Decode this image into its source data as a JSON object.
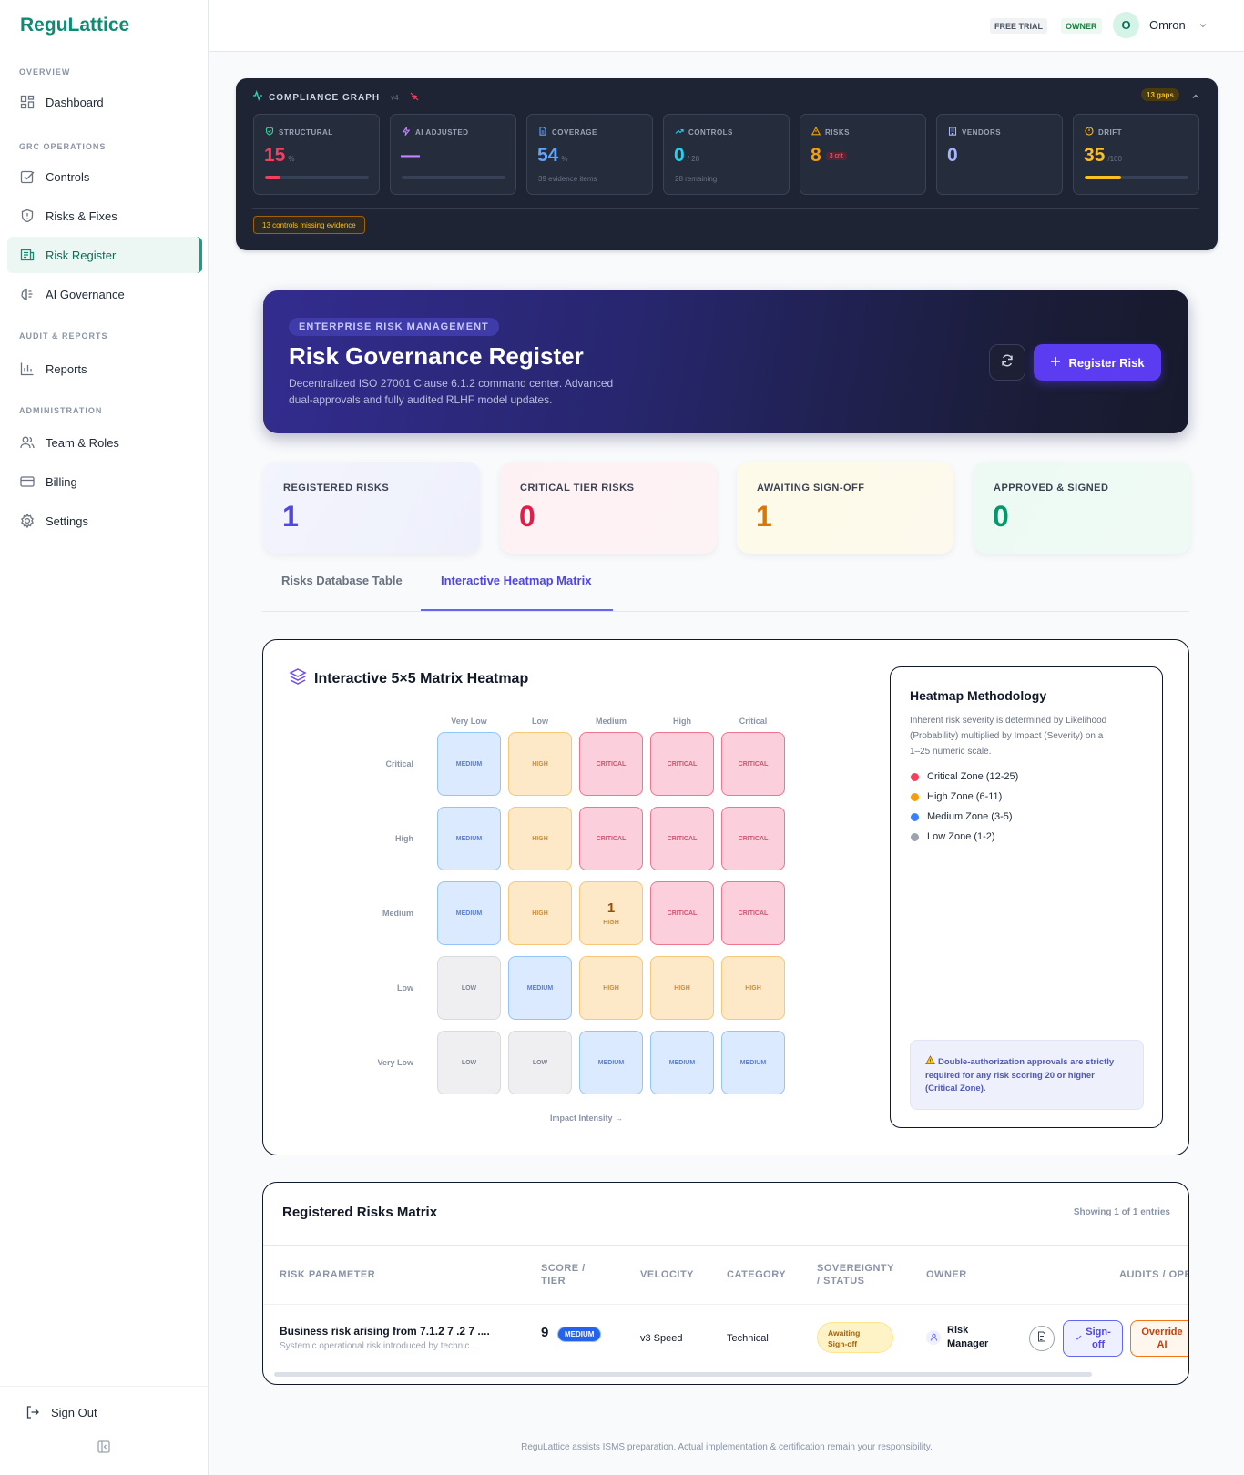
{
  "sidebar": {
    "brand": "ReguLattice",
    "sections": [
      "OVERVIEW",
      "GRC OPERATIONS",
      "AUDIT & REPORTS",
      "ADMINISTRATION"
    ],
    "items": [
      {
        "label": "Dashboard",
        "icon": "grid-icon"
      },
      {
        "label": "Controls",
        "icon": "checkbox-icon"
      },
      {
        "label": "Risks & Fixes",
        "icon": "shield-alert-icon"
      },
      {
        "label": "Risk Register",
        "icon": "register-icon",
        "active": true
      },
      {
        "label": "AI Governance",
        "icon": "brain-icon"
      },
      {
        "label": "Reports",
        "icon": "bar-chart-icon"
      },
      {
        "label": "Team & Roles",
        "icon": "users-icon"
      },
      {
        "label": "Billing",
        "icon": "credit-card-icon"
      },
      {
        "label": "Settings",
        "icon": "gear-icon"
      }
    ],
    "sign_out": "Sign Out"
  },
  "topbar": {
    "free_trial": "FREE TRIAL",
    "role": "OWNER",
    "avatar_initial": "O",
    "user_name": "Omron"
  },
  "compliance_graph": {
    "title": "COMPLIANCE GRAPH",
    "version": "v4",
    "gaps": "13 gaps",
    "cards": [
      {
        "label": "STRUCTURAL",
        "value": "15",
        "unit": "%",
        "progress": 0.15,
        "color": "#f43f5e"
      },
      {
        "label": "AI ADJUSTED",
        "value": "—",
        "progress": 0,
        "color": "#c084fc"
      },
      {
        "label": "COVERAGE",
        "value": "54",
        "unit": "%",
        "sub": "39 evidence items",
        "color": "#60a5fa"
      },
      {
        "label": "CONTROLS",
        "value": "0",
        "unit": "/ 28",
        "sub": "28 remaining",
        "color": "#22d3ee"
      },
      {
        "label": "RISKS",
        "value": "8",
        "badge": "3 crit",
        "color": "#f59e0b"
      },
      {
        "label": "VENDORS",
        "value": "0",
        "color": "#a5b4fc"
      },
      {
        "label": "DRIFT",
        "value": "35",
        "unit": "/100",
        "progress": 0.35,
        "color": "#fbbf24"
      }
    ],
    "alert": "13 controls missing evidence"
  },
  "hero": {
    "eyebrow": "ENTERPRISE RISK MANAGEMENT",
    "title": "Risk Governance Register",
    "desc1": "Decentralized ISO 27001 Clause 6.1.2 command center. Advanced",
    "desc2": "dual-approvals and fully audited RLHF model updates.",
    "register_button": "Register Risk"
  },
  "stats": [
    {
      "label": "REGISTERED RISKS",
      "value": "1"
    },
    {
      "label": "CRITICAL TIER RISKS",
      "value": "0"
    },
    {
      "label": "AWAITING SIGN-OFF",
      "value": "1"
    },
    {
      "label": "APPROVED & SIGNED",
      "value": "0"
    }
  ],
  "tabs": [
    "Risks Database Table",
    "Interactive Heatmap Matrix"
  ],
  "heatmap": {
    "title": "Interactive 5×5 Matrix Heatmap",
    "columns": [
      "Very Low",
      "Low",
      "Medium",
      "High",
      "Critical"
    ],
    "rows": [
      "Critical",
      "High",
      "Medium",
      "Low",
      "Very Low"
    ],
    "cells": [
      [
        "MEDIUM",
        "HIGH",
        "CRITICAL",
        "CRITICAL",
        "CRITICAL"
      ],
      [
        "MEDIUM",
        "HIGH",
        "CRITICAL",
        "CRITICAL",
        "CRITICAL"
      ],
      [
        "MEDIUM",
        "HIGH",
        "HIGH",
        "CRITICAL",
        "CRITICAL"
      ],
      [
        "LOW",
        "MEDIUM",
        "HIGH",
        "HIGH",
        "HIGH"
      ],
      [
        "LOW",
        "LOW",
        "MEDIUM",
        "MEDIUM",
        "MEDIUM"
      ]
    ],
    "counts": [
      [
        "",
        "",
        "",
        "",
        ""
      ],
      [
        "",
        "",
        "",
        "",
        ""
      ],
      [
        "",
        "",
        "1",
        "",
        ""
      ],
      [
        "",
        "",
        "",
        "",
        ""
      ],
      [
        "",
        "",
        "",
        "",
        ""
      ]
    ],
    "x_axis_label": "Impact Intensity →"
  },
  "methodology": {
    "title": "Heatmap Methodology",
    "desc1": "Inherent risk severity is determined by Likelihood",
    "desc2": "(Probability) multiplied by Impact (Severity) on a",
    "desc3": "1–25 numeric scale.",
    "legend": [
      {
        "label": "Critical Zone (12-25)",
        "color": "#f43f5e"
      },
      {
        "label": "High Zone (6-11)",
        "color": "#f59e0b"
      },
      {
        "label": "Medium Zone (3-5)",
        "color": "#3b82f6"
      },
      {
        "label": "Low Zone (1-2)",
        "color": "#9ca3af"
      }
    ],
    "note1": "Double-authorization approvals are strictly",
    "note2": "required for any risk scoring 20 or higher",
    "note3": "(Critical Zone)."
  },
  "table": {
    "title": "Registered Risks Matrix",
    "showing": "Showing 1 of 1 entries",
    "headers": {
      "param": "RISK PARAMETER",
      "score1": "SCORE /",
      "score2": "TIER",
      "velocity": "VELOCITY",
      "category": "CATEGORY",
      "sov1": "SOVEREIGNTY",
      "sov2": "/ STATUS",
      "owner": "OWNER",
      "audits": "AUDITS / OPE"
    },
    "row": {
      "title": "Business risk arising from 7.1.2 7 .2 7 ....",
      "subtitle": "Systemic operational risk introduced by technic...",
      "score": "9",
      "tier": "MEDIUM",
      "velocity": "v3 Speed",
      "category": "Technical",
      "status1": "Awaiting",
      "status2": "Sign-off",
      "owner1": "Risk",
      "owner2": "Manager",
      "signoff1": "Sign-",
      "signoff2": "off",
      "override1": "Override",
      "override2": "AI"
    }
  },
  "footer": "ReguLattice assists ISMS preparation. Actual implementation & certification remain your responsibility."
}
